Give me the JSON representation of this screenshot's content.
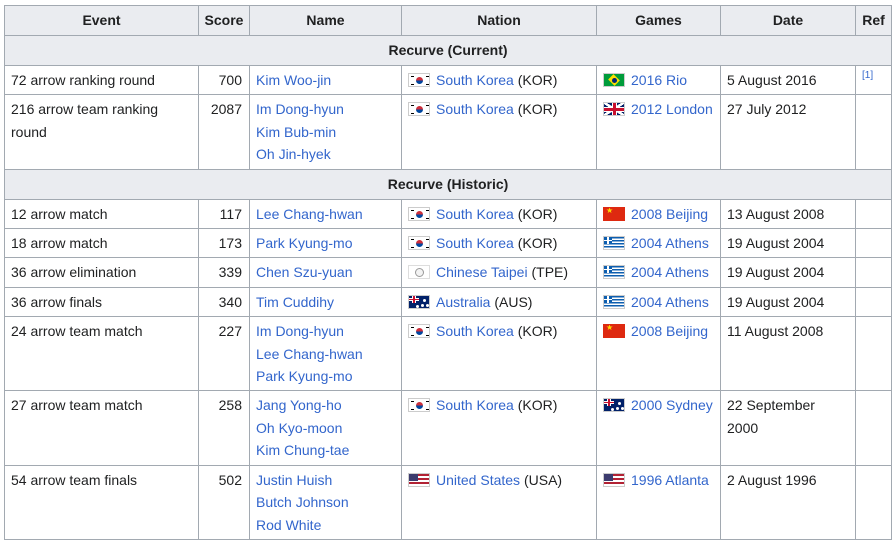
{
  "headers": [
    "Event",
    "Score",
    "Name",
    "Nation",
    "Games",
    "Date",
    "Ref"
  ],
  "sections": [
    {
      "title": "Recurve (Current)",
      "rows": [
        {
          "event": "72 arrow ranking round",
          "score": "700",
          "names": [
            "Kim Woo-jin"
          ],
          "nation": "South Korea",
          "nation_code": "(KOR)",
          "nation_flag": "kr",
          "games": "2016 Rio",
          "games_flag": "br",
          "date": "5 August 2016",
          "ref": "[1]"
        },
        {
          "event": "216 arrow team ranking round",
          "score": "2087",
          "names": [
            "Im Dong-hyun",
            "Kim Bub-min",
            "Oh Jin-hyek"
          ],
          "nation": "South Korea",
          "nation_code": "(KOR)",
          "nation_flag": "kr",
          "games": "2012 London",
          "games_flag": "gb",
          "date": "27 July 2012",
          "ref": ""
        }
      ]
    },
    {
      "title": "Recurve (Historic)",
      "rows": [
        {
          "event": "12 arrow match",
          "score": "117",
          "names": [
            "Lee Chang-hwan"
          ],
          "nation": "South Korea",
          "nation_code": "(KOR)",
          "nation_flag": "kr",
          "games": "2008 Beijing",
          "games_flag": "cn",
          "date": "13 August 2008",
          "ref": ""
        },
        {
          "event": "18 arrow match",
          "score": "173",
          "names": [
            "Park Kyung-mo"
          ],
          "nation": "South Korea",
          "nation_code": "(KOR)",
          "nation_flag": "kr",
          "games": "2004 Athens",
          "games_flag": "gr",
          "date": "19 August 2004",
          "ref": ""
        },
        {
          "event": "36 arrow elimination",
          "score": "339",
          "names": [
            "Chen Szu-yuan"
          ],
          "nation": "Chinese Taipei",
          "nation_code": "(TPE)",
          "nation_flag": "tw",
          "games": "2004 Athens",
          "games_flag": "gr",
          "date": "19 August 2004",
          "ref": ""
        },
        {
          "event": "36 arrow finals",
          "score": "340",
          "names": [
            "Tim Cuddihy"
          ],
          "nation": "Australia",
          "nation_code": "(AUS)",
          "nation_flag": "au",
          "games": "2004 Athens",
          "games_flag": "gr",
          "date": "19 August 2004",
          "ref": ""
        },
        {
          "event": "24 arrow team match",
          "score": "227",
          "names": [
            "Im Dong-hyun",
            "Lee Chang-hwan",
            "Park Kyung-mo"
          ],
          "nation": "South Korea",
          "nation_code": "(KOR)",
          "nation_flag": "kr",
          "games": "2008 Beijing",
          "games_flag": "cn",
          "date": "11 August 2008",
          "ref": ""
        },
        {
          "event": "27 arrow team match",
          "score": "258",
          "names": [
            "Jang Yong-ho",
            "Oh Kyo-moon",
            "Kim Chung-tae"
          ],
          "nation": "South Korea",
          "nation_code": "(KOR)",
          "nation_flag": "kr",
          "games": "2000 Sydney",
          "games_flag": "au",
          "date": "22 September 2000",
          "ref": ""
        },
        {
          "event": "54 arrow team finals",
          "score": "502",
          "names": [
            "Justin Huish",
            "Butch Johnson",
            "Rod White"
          ],
          "nation": "United States",
          "nation_code": "(USA)",
          "nation_flag": "us",
          "games": "1996 Atlanta",
          "games_flag": "us",
          "date": "2 August 1996",
          "ref": ""
        }
      ]
    }
  ]
}
